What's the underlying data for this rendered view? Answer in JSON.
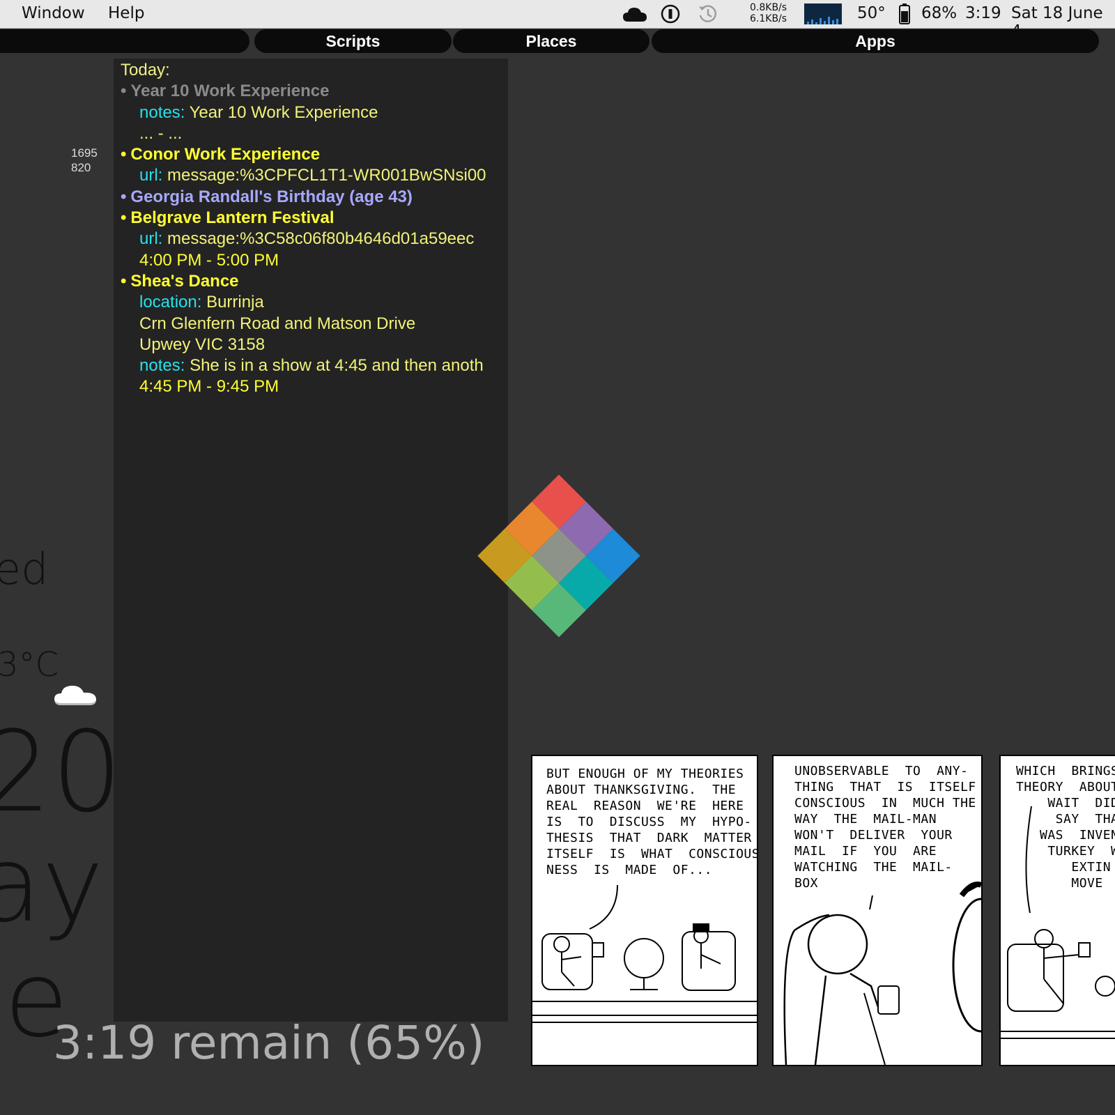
{
  "menubar": {
    "menus": [
      "Window",
      "Help"
    ],
    "net_up": "0.8KB/s",
    "net_down": "6.1KB/s",
    "temperature": "50°",
    "battery": "68%",
    "clock": "3:19",
    "date": "Sat 18 June 4",
    "icons": [
      "cloud-icon",
      "onepassword-icon",
      "time-machine-icon",
      "network-graph-icon",
      "battery-icon"
    ]
  },
  "tabs": [
    "Scripts",
    "Places",
    "Apps"
  ],
  "side_numbers": [
    "1695",
    "820"
  ],
  "calendar": {
    "header": "Today:",
    "events": [
      {
        "bullet": "•",
        "title": "Year 10 Work Experience",
        "style": "grey",
        "details": [
          {
            "key": "notes:",
            "value": "Year 10 Work Experience"
          },
          {
            "key": "",
            "value": "... - ..."
          }
        ]
      },
      {
        "bullet": "•",
        "title": "Conor Work Experience",
        "style": "yellow",
        "details": [
          {
            "key": "url:",
            "value": "message:%3CPFCL1T1-WR001BwSNsi00"
          }
        ]
      },
      {
        "bullet": "•",
        "title": "Georgia Randall's Birthday (age 43)",
        "style": "purple",
        "details": []
      },
      {
        "bullet": "•",
        "title": "Belgrave Lantern Festival",
        "style": "yellow",
        "details": [
          {
            "key": "url:",
            "value": "message:%3C58c06f80b4646d01a59eec"
          },
          {
            "key": "",
            "value": "4:00 PM - 5:00 PM",
            "is_time": true
          }
        ]
      },
      {
        "bullet": "•",
        "title": "Shea's Dance",
        "style": "yellow",
        "details": [
          {
            "key": "location:",
            "value": "Burrinja"
          },
          {
            "key": "",
            "value": "Crn Glenfern Road and Matson Drive"
          },
          {
            "key": "",
            "value": "Upwey VIC 3158"
          },
          {
            "key": "notes:",
            "value": "She is in a show at 4:45 and then anoth"
          },
          {
            "key": "",
            "value": "4:45 PM - 9:45 PM",
            "is_time": true
          }
        ]
      }
    ]
  },
  "clock_widget": {
    "fragments": [
      "ed",
      "3°C",
      "20",
      "ay",
      "e"
    ],
    "battery_remaining": "3:19 remain (65%)"
  },
  "comic": {
    "panels": [
      "BUT ENOUGH OF MY THEORIES\nABOUT THANKSGIVING.  THE\nREAL  REASON  WE'RE  HERE\nIS  TO  DISCUSS  MY  HYPO-\nTHESIS  THAT  DARK  MATTER\nITSELF  IS  WHAT  CONSCIOUS-\nNESS  IS  MADE  OF...",
      "UNOBSERVABLE  TO  ANY-\nTHING  THAT  IS  ITSELF\nCONSCIOUS  IN  MUCH THE\nWAY  THE  MAIL-MAN\nWON'T  DELIVER  YOUR\nMAIL  IF  YOU  ARE\nWATCHING  THE  MAIL-\nBOX",
      "WHICH  BRINGS  U\nTHEORY  ABOUT  O\n    WAIT  DID\n     SAY  THAN\n   WAS  INVEN\n    TURKEY  W\n       EXTIN\n       MOVE"
    ]
  },
  "colors": {
    "background": "#333333",
    "panel": "#232323",
    "event_yellow": "#ffff33",
    "event_purple": "#a8a8ff",
    "key_cyan": "#25e2ea"
  }
}
